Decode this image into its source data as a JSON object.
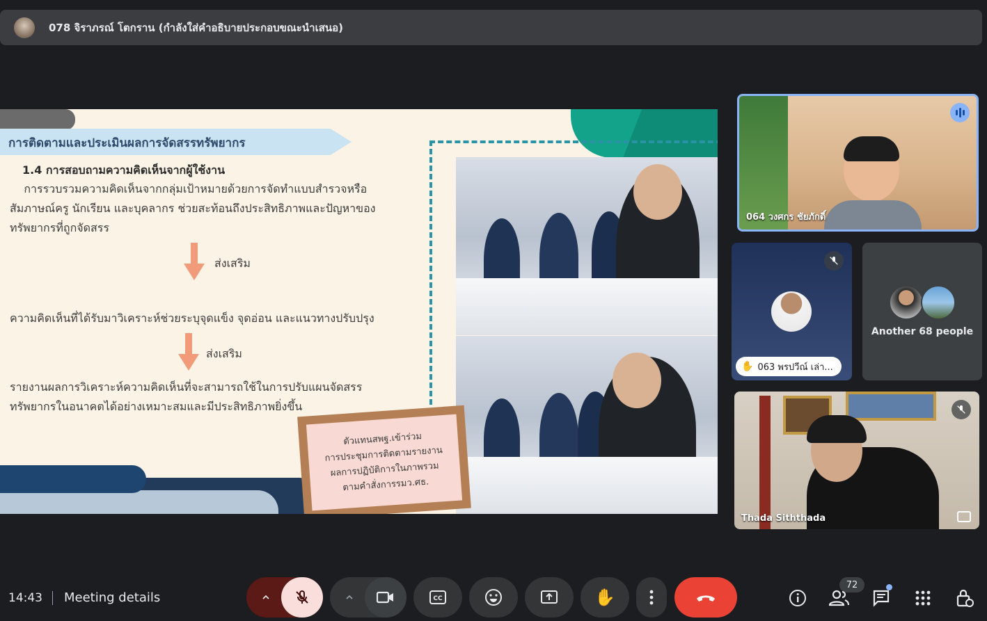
{
  "presenter_bar": {
    "title": "078 จิราภรณ์ โตกราน (กำลังใส่คำอธิบายประกอบขณะนำเสนอ)"
  },
  "slide": {
    "section_title": "การติดตามและประเมินผลการจัดสรรทรัพยากร",
    "sub_heading": "1.4 การสอบถามความคิดเห็นจากผู้ใช้งาน",
    "paragraph_lines": [
      "    การรวบรวมความคิดเห็นจากกลุ่มเป้าหมายด้วยการจัดทำแบบสำรวจหรือ",
      "สัมภาษณ์ครู นักเรียน และบุคลากร ช่วยสะท้อนถึงประสิทธิภาพและปัญหาของ",
      "ทรัพยากรที่ถูกจัดสรร"
    ],
    "arrow1_label": "ส่งเสริม",
    "middle_line": "ความคิดเห็นที่ได้รับมาวิเคราะห์ช่วยระบุจุดแข็ง จุดอ่อน และแนวทางปรับปรุง",
    "arrow2_label": "ส่งเสริม",
    "final_lines": [
      "รายงานผลการวิเคราะห์ความคิดเห็นที่จะสามารถใช้ในการปรับแผนจัดสรร",
      "ทรัพยากรในอนาคตได้อย่างเหมาะสมและมีประสิทธิภาพยิ่งขึ้น"
    ],
    "note_lines": [
      "ตัวแทนสพฐ.เข้าร่วม",
      "การประชุมการติดตามรายงาน",
      "ผลการปฏิบัติการในภาพรวม",
      "ตามคำสั่งการรมว.ศธ."
    ]
  },
  "participants": {
    "tile1": {
      "name": "064 วงศกร ชัยภักดิ์",
      "state": "speaking"
    },
    "tile2": {
      "name": "063 พรปวีณ์ เล่า...",
      "state": "hand-raised, muted"
    },
    "tile3": {
      "label": "Another 68 people"
    },
    "tile4": {
      "name": "Thada Siththada",
      "state": "muted"
    }
  },
  "bottom_bar": {
    "time": "14:43",
    "meeting_details": "Meeting details",
    "participant_count": "72",
    "controls": [
      "more-audio",
      "mic-off",
      "more-video",
      "camera",
      "captions",
      "emoji",
      "present",
      "raise-hand",
      "more-options",
      "leave-call"
    ],
    "right_controls": [
      "info",
      "people",
      "chat",
      "activities",
      "host-controls"
    ]
  },
  "colors": {
    "background": "#1c1d20",
    "end_call": "#ea4335",
    "mic_off_bg": "#f9dedc",
    "accent_blue": "#8ab4f8"
  }
}
